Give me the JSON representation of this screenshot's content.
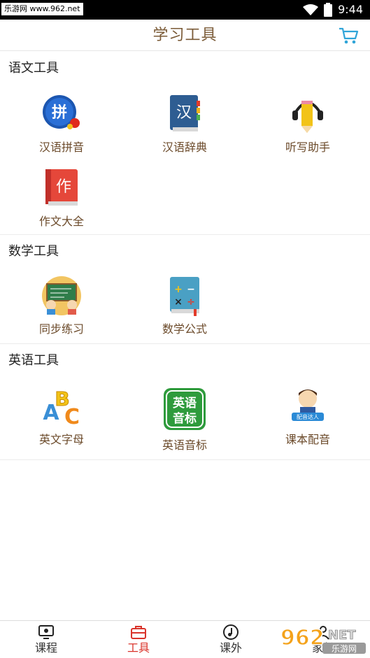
{
  "status_bar": {
    "watermark": "乐游网 www.962.net",
    "time": "9:44"
  },
  "header": {
    "title": "学习工具"
  },
  "sections": [
    {
      "title": "语文工具",
      "tools": [
        {
          "label": "汉语拼音",
          "icon": "pinyin-icon"
        },
        {
          "label": "汉语辞典",
          "icon": "dictionary-book-icon",
          "icon_text": "汉"
        },
        {
          "label": "听写助手",
          "icon": "pencil-headphones-icon"
        },
        {
          "label": "作文大全",
          "icon": "composition-book-icon",
          "icon_text": "作"
        }
      ]
    },
    {
      "title": "数学工具",
      "tools": [
        {
          "label": "同步练习",
          "icon": "classroom-blackboard-icon"
        },
        {
          "label": "数学公式",
          "icon": "math-formula-book-icon"
        }
      ]
    },
    {
      "title": "英语工具",
      "tools": [
        {
          "label": "英文字母",
          "icon": "abc-letters-icon",
          "icon_text": [
            "A",
            "B",
            "C"
          ]
        },
        {
          "label": "英语音标",
          "icon": "phonetic-symbol-icon",
          "icon_text": [
            "英语",
            "音标"
          ]
        },
        {
          "label": "课本配音",
          "icon": "dubbing-character-icon",
          "icon_text": "配音达人"
        }
      ]
    }
  ],
  "bottom_nav": [
    {
      "label": "课程",
      "icon": "course-icon",
      "active": false
    },
    {
      "label": "工具",
      "icon": "toolbox-icon",
      "active": true
    },
    {
      "label": "课外",
      "icon": "music-note-icon",
      "active": false
    },
    {
      "label": "家长",
      "icon": "parent-icon",
      "active": false
    }
  ],
  "watermark_bottom": {
    "text_main": "962",
    "text_net": "NET",
    "text_sub": "乐游网"
  },
  "colors": {
    "accent": "#d9332a",
    "title_brown": "#7a5a36",
    "label_brown": "#6b4a2a",
    "cart_blue": "#2fa4d8"
  }
}
